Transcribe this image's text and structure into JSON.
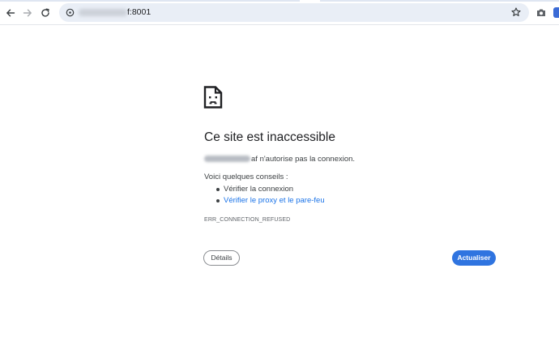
{
  "browser": {
    "address_bar": {
      "url_visible": "f:8001"
    },
    "icons": {
      "back": "arrow-left-icon",
      "forward": "arrow-right-icon",
      "reload": "reload-icon",
      "site_info": "site-info-icon",
      "bookmark": "star-icon",
      "screenshot": "camera-icon"
    }
  },
  "error_page": {
    "icon": "sad-document-icon",
    "title": "Ce site est inaccessible",
    "host_suffix": "af",
    "host_message": " n'autorise pas la connexion.",
    "tips_heading": "Voici quelques conseils :",
    "tips": [
      {
        "label": "Vérifier la connexion",
        "is_link": false
      },
      {
        "label": "Vérifier le proxy et le pare-feu",
        "is_link": true
      }
    ],
    "error_code": "ERR_CONNECTION_REFUSED",
    "details_button": "Détails",
    "reload_button": "Actualiser"
  },
  "colors": {
    "accent": "#2f74e0",
    "link": "#1a73e8",
    "omnibox_bg": "#e9eef6"
  }
}
